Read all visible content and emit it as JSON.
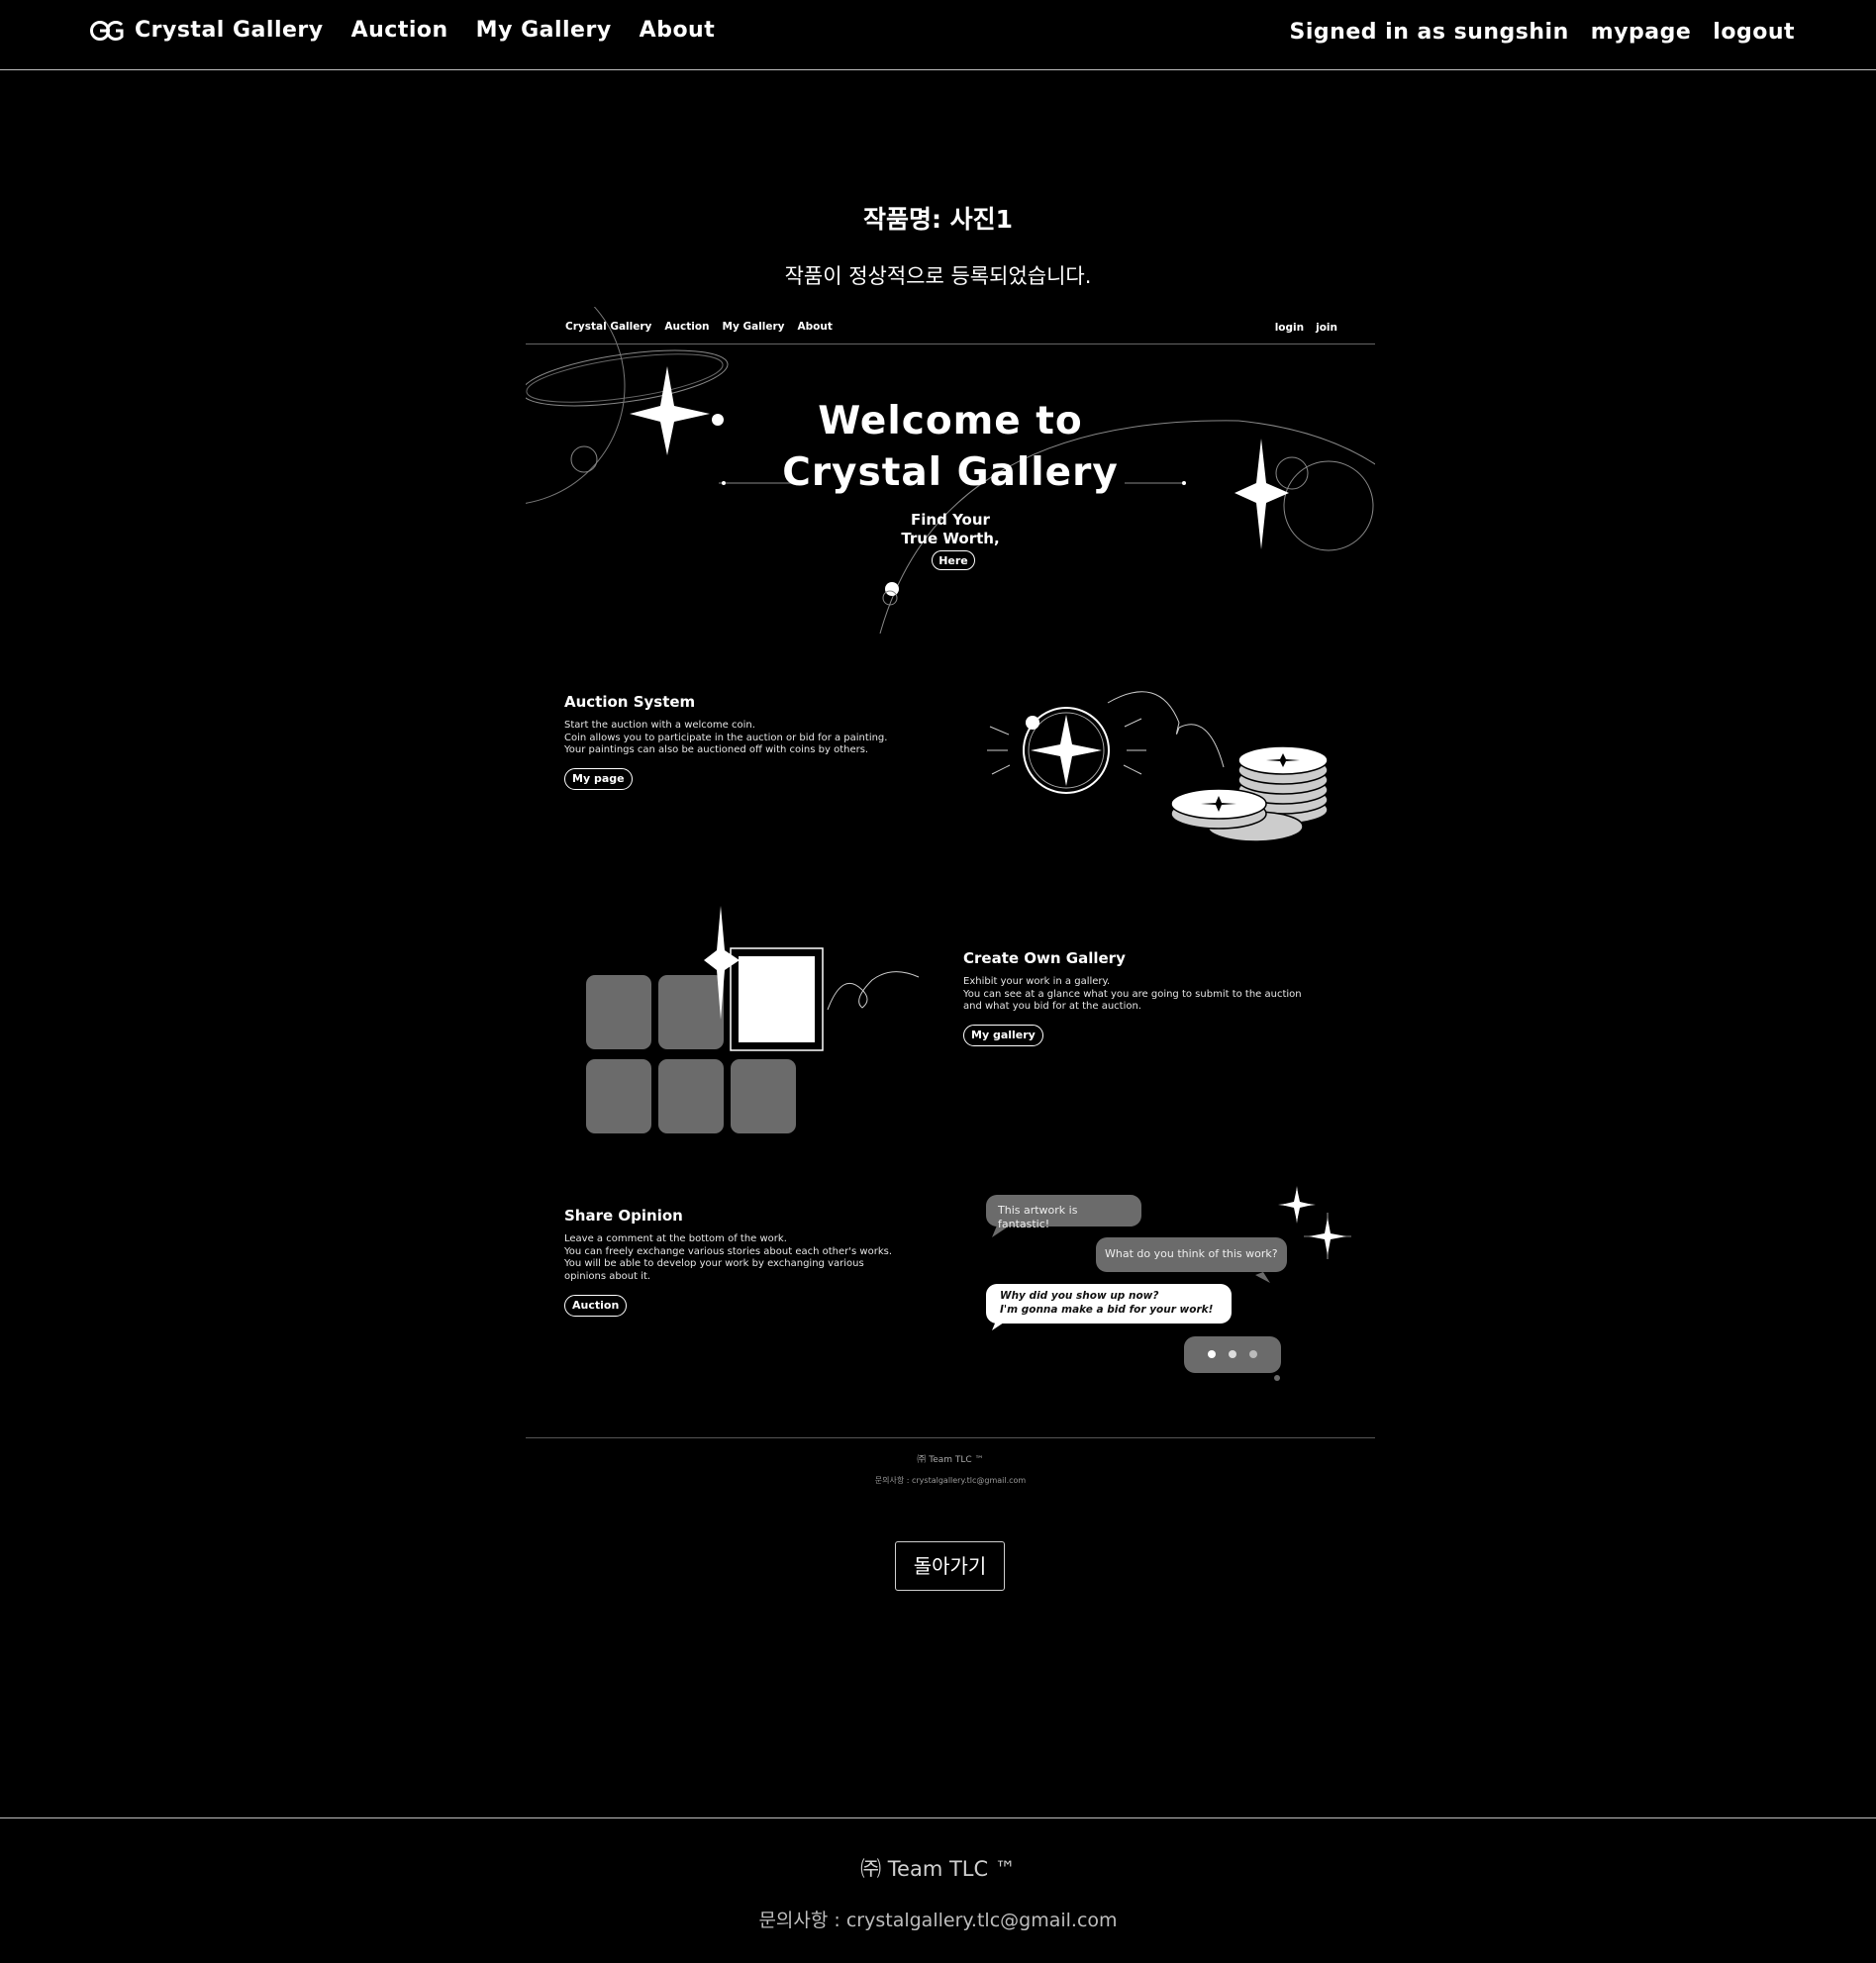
{
  "nav": {
    "brand": "Crystal Gallery",
    "links": [
      "Auction",
      "My Gallery",
      "About"
    ],
    "signed_in": "Signed in as sungshin",
    "mypage": "mypage",
    "logout": "logout"
  },
  "main": {
    "title": "작품명: 사진1",
    "message": "작품이 정상적으로 등록되었습니다.",
    "back_button": "돌아가기"
  },
  "artwork": {
    "nav": {
      "brand": "Crystal Gallery",
      "links": [
        "Auction",
        "My Gallery",
        "About"
      ],
      "login": "login",
      "join": "join"
    },
    "hero": {
      "line1": "Welcome to",
      "line2": "Crystal Gallery",
      "find1": "Find Your",
      "find2": "True Worth,",
      "button": "Here"
    },
    "auction": {
      "title": "Auction System",
      "lines": [
        "Start the auction with a welcome coin.",
        "Coin allows you to participate in the auction or bid for a painting.",
        "Your paintings can also be auctioned off with coins by others."
      ],
      "button": "My page"
    },
    "gallery": {
      "title": "Create Own Gallery",
      "lines": [
        "Exhibit your work in a gallery.",
        "You can see at a glance what you are going to submit to the auction",
        "and what you bid for at the auction."
      ],
      "button": "My gallery"
    },
    "opinion": {
      "title": "Share Opinion",
      "lines": [
        "Leave a comment at the bottom of the work.",
        "You can freely exchange various stories about each other's works.",
        "You will be able to develop your work by exchanging various",
        "opinions about it."
      ],
      "button": "Auction",
      "bubbles": [
        "This artwork is fantastic!",
        "What do you think of this work?",
        "Why did you show up now?",
        "I'm gonna make a bid for your work!"
      ]
    },
    "footer": {
      "team": "㈜ Team TLC ™",
      "contact": "문의사항 : crystalgallery.tlc@gmail.com"
    }
  },
  "footer": {
    "team": "㈜ Team TLC ™",
    "contact": "문의사항 : crystalgallery.tlc@gmail.com"
  },
  "colors": {
    "background": "#000000",
    "text": "#ffffff",
    "divider": "#bdbdbd",
    "tile_gray": "#6b6b6b"
  }
}
